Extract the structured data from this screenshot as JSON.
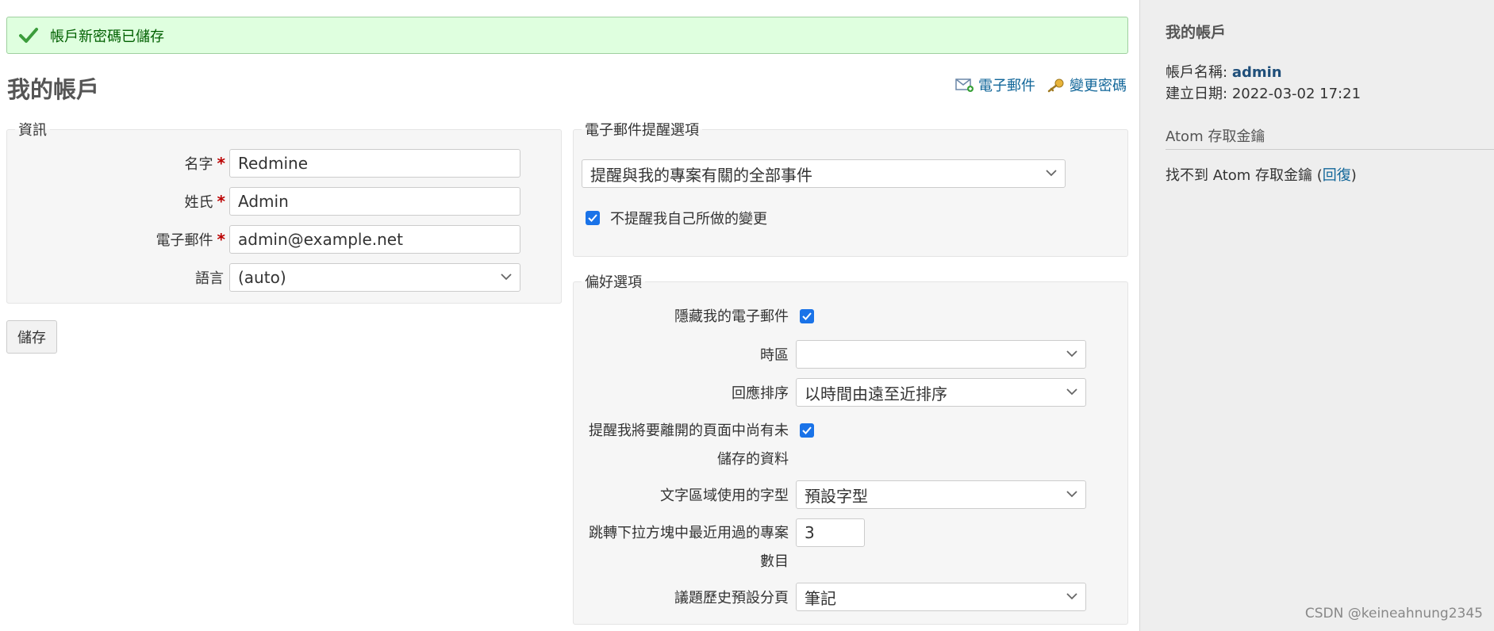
{
  "flash": {
    "message": "帳戶新密碼已儲存"
  },
  "page": {
    "title": "我的帳戶"
  },
  "contextual": {
    "email_link": "電子郵件",
    "password_link": "變更密碼"
  },
  "info": {
    "legend": "資訊",
    "firstname": {
      "label": "名字",
      "value": "Redmine"
    },
    "lastname": {
      "label": "姓氏",
      "value": "Admin"
    },
    "email": {
      "label": "電子郵件",
      "value": "admin@example.net"
    },
    "language": {
      "label": "語言",
      "value": "(auto)"
    },
    "required_mark": "*"
  },
  "save_button": "儲存",
  "notifications": {
    "legend": "電子郵件提醒選項",
    "select_value": "提醒與我的專案有關的全部事件",
    "no_self_notified": {
      "label": "不提醒我自己所做的變更",
      "checked": true
    }
  },
  "preferences": {
    "legend": "偏好選項",
    "hide_mail": {
      "label": "隱藏我的電子郵件",
      "checked": true
    },
    "timezone": {
      "label": "時區",
      "value": ""
    },
    "comments_sorting": {
      "label": "回應排序",
      "value": "以時間由遠至近排序"
    },
    "warn_unsaved": {
      "label_line1": "提醒我將要離開的頁面中尚有未",
      "label_line2": "儲存的資料",
      "checked": true
    },
    "textarea_font": {
      "label": "文字區域使用的字型",
      "value": "預設字型"
    },
    "recent_projects": {
      "label_line1": "跳轉下拉方塊中最近用過的專案",
      "label_line2": "數目",
      "value": "3"
    },
    "history_tab": {
      "label": "議題歷史預設分頁",
      "value": "筆記"
    }
  },
  "sidebar": {
    "title": "我的帳戶",
    "login_label": "帳戶名稱:",
    "login_value": "admin",
    "created_label": "建立日期:",
    "created_value": "2022-03-02 17:21",
    "atom_heading": "Atom 存取金鑰",
    "atom_text": "找不到 Atom 存取金鑰 (",
    "atom_reset": "回復",
    "atom_close": ")"
  },
  "watermark": "CSDN @keineahnung2345",
  "colors": {
    "flash_bg": "#dfffdf",
    "link": "#116699",
    "required": "#bb0000",
    "checkbox": "#1a73e8"
  }
}
